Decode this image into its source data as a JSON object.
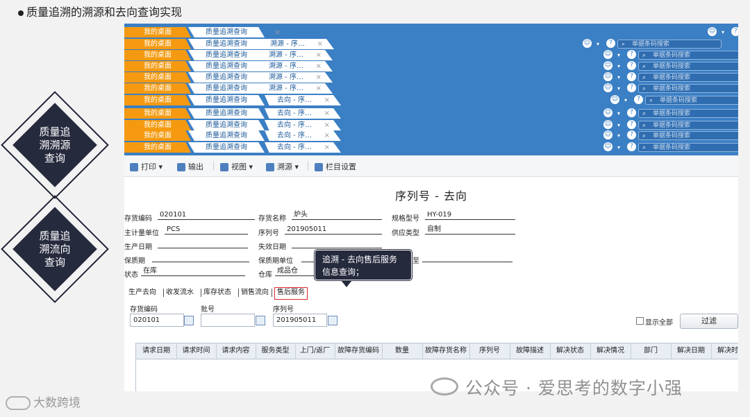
{
  "slide_title": "质量追溯的溯源和去向查询实现",
  "left_labels": [
    "质量追\n溯溯源\n查询",
    "质量追\n溯流向\n查询"
  ],
  "tab_rows": [
    {
      "home": "我的桌面",
      "trace": "质量追溯查询",
      "sub": "",
      "search": "单据条码搜索"
    },
    {
      "home": "我的桌面",
      "trace": "质量追溯查询",
      "sub": "溯源 - 序…",
      "search": "单据条码搜索"
    },
    {
      "home": "我的桌面",
      "trace": "质量追溯查询",
      "sub": "溯源 - 序…",
      "search": "单据条码搜索"
    },
    {
      "home": "我的桌面",
      "trace": "质量追溯查询",
      "sub": "溯源 - 序…",
      "search": "单据条码搜索"
    },
    {
      "home": "我的桌面",
      "trace": "质量追溯查询",
      "sub": "溯源 - 序…",
      "search": "单据条码搜索"
    },
    {
      "home": "我的桌面",
      "trace": "质量追溯查询",
      "sub": "溯源 - 序…",
      "search": "单据条码搜索"
    },
    {
      "home": "我的桌面",
      "trace": "质量追溯查询",
      "sub": "去向 - 序…",
      "search": "单据条码搜索"
    },
    {
      "home": "我的桌面",
      "trace": "质量追溯查询",
      "sub": "去向 - 序…",
      "search": "单据条码搜索"
    },
    {
      "home": "我的桌面",
      "trace": "质量追溯查询",
      "sub": "去向 - 序…",
      "search": "单据条码搜索"
    },
    {
      "home": "我的桌面",
      "trace": "质量追溯查询",
      "sub": "去向 - 序…",
      "search": "单据条码搜索"
    },
    {
      "home": "我的桌面",
      "trace": "质量追溯查询",
      "sub": "去向 - 序…",
      "search": "单据条码搜索"
    }
  ],
  "toolbar": {
    "print": "打印",
    "export": "输出",
    "view": "视图",
    "trace_source": "溯源",
    "column_settings": "栏目设置"
  },
  "form": {
    "title": "序列号 - 去向",
    "fields": [
      {
        "label": "存货编码",
        "value": "020101"
      },
      {
        "label": "存货名称",
        "value": "炉头"
      },
      {
        "label": "规格型号",
        "value": "HY-019"
      },
      {
        "label": "主计量单位",
        "value": "PCS"
      },
      {
        "label": "序列号",
        "value": "201905011"
      },
      {
        "label": "供应类型",
        "value": "自制"
      },
      {
        "label": "生产日期",
        "value": ""
      },
      {
        "label": "失效日期",
        "value": ""
      },
      {
        "label": "保质期",
        "value": ""
      },
      {
        "label": "保质期单位",
        "value": ""
      },
      {
        "label": "至",
        "value": ""
      },
      {
        "label": "状态",
        "value": "在库"
      },
      {
        "label": "仓库",
        "value": "成品仓"
      }
    ]
  },
  "callout": "追溯 - 去向售后服务信息查询；",
  "subtabs": [
    "生产去向",
    "收发流水",
    "库存状态",
    "销售流向",
    "售后服务"
  ],
  "query": {
    "item_code_label": "存货编码",
    "item_code_value": "020101",
    "batch_label": "批号",
    "batch_value": "",
    "serial_label": "序列号",
    "serial_value": "201905011",
    "show_all": "显示全部",
    "filter": "过滤"
  },
  "grid_columns": [
    "请求日期",
    "请求时间",
    "请求内容",
    "服务类型",
    "上门/返厂",
    "故障存货编码",
    "数量",
    "故障存货名称",
    "序列号",
    "故障描述",
    "解决状态",
    "解决情况",
    "部门",
    "解决日期",
    "解决时"
  ],
  "watermark": "公众号 · 爱思考的数字小强",
  "brand": "大数跨境",
  "colors": {
    "tab_band": "#3b7fc4",
    "home_tab": "#f59a10",
    "diamond": "#262a3d",
    "active_border": "#d8262f"
  }
}
